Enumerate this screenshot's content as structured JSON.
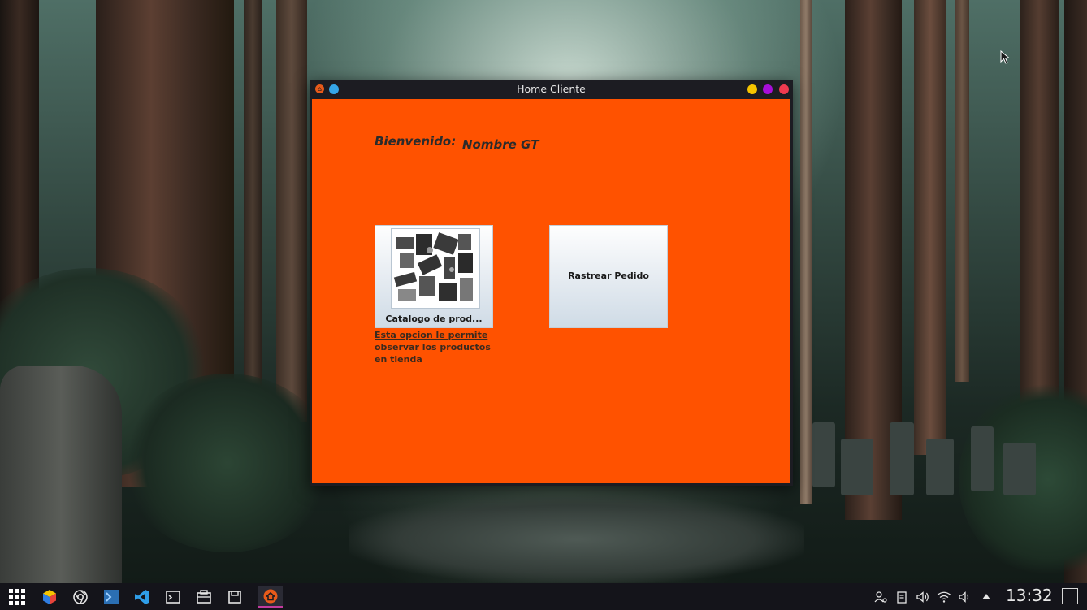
{
  "window": {
    "title": "Home Cliente",
    "app_icon": "home-icon"
  },
  "content": {
    "welcome_label": "Bienvenido:",
    "username": "Nombre GT",
    "catalog_button_label": "Catalogo de prod...",
    "catalog_description": [
      "Esta opcion le permite",
      "observar los productos",
      "en tienda"
    ],
    "track_button_label": "Rastrear Pedido",
    "background_color": "#ff5200"
  },
  "taskbar": {
    "launchers": [
      "app-grid-icon",
      "color-cube-icon",
      "chrome-icon",
      "terminal-blue-icon",
      "vscode-icon",
      "console-icon",
      "window-icon",
      "package-icon",
      "editor-icon",
      "home-app-icon"
    ],
    "tray_icons": [
      "network-user-icon",
      "clipboard-icon",
      "volume-icon",
      "wifi-icon",
      "speaker-icon",
      "arrow-up-icon"
    ],
    "clock": "13:32"
  }
}
